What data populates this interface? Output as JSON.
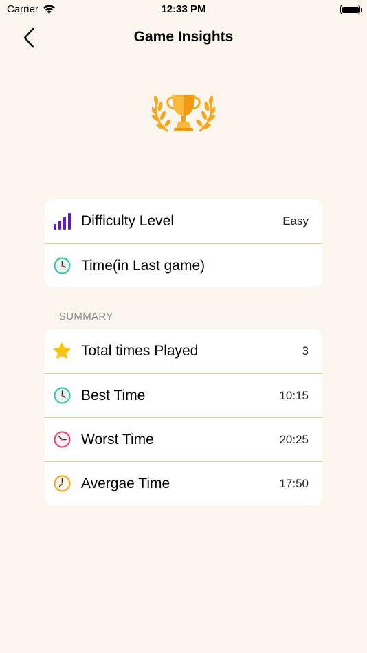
{
  "status_bar": {
    "carrier": "Carrier",
    "time": "12:33 PM"
  },
  "nav": {
    "title": "Game Insights"
  },
  "details": [
    {
      "icon": "signal-bars-icon",
      "label": "Difficulty Level",
      "value": "Easy"
    },
    {
      "icon": "clock-teal-icon",
      "label": "Time(in Last game)",
      "value": ""
    }
  ],
  "summary": {
    "header": "SUMMARY",
    "rows": [
      {
        "icon": "star-icon",
        "label": "Total times Played",
        "value": "3"
      },
      {
        "icon": "clock-teal-icon",
        "label": "Best Time",
        "value": "10:15"
      },
      {
        "icon": "clock-red-icon",
        "label": "Worst Time",
        "value": "20:25"
      },
      {
        "icon": "clock-orange-icon",
        "label": "Avergae Time",
        "value": "17:50"
      }
    ]
  },
  "colors": {
    "background": "#faf6ee",
    "divider": "#f1c98d",
    "trophy_gold": "#f7a823",
    "signal_purple": "#6215e0"
  }
}
